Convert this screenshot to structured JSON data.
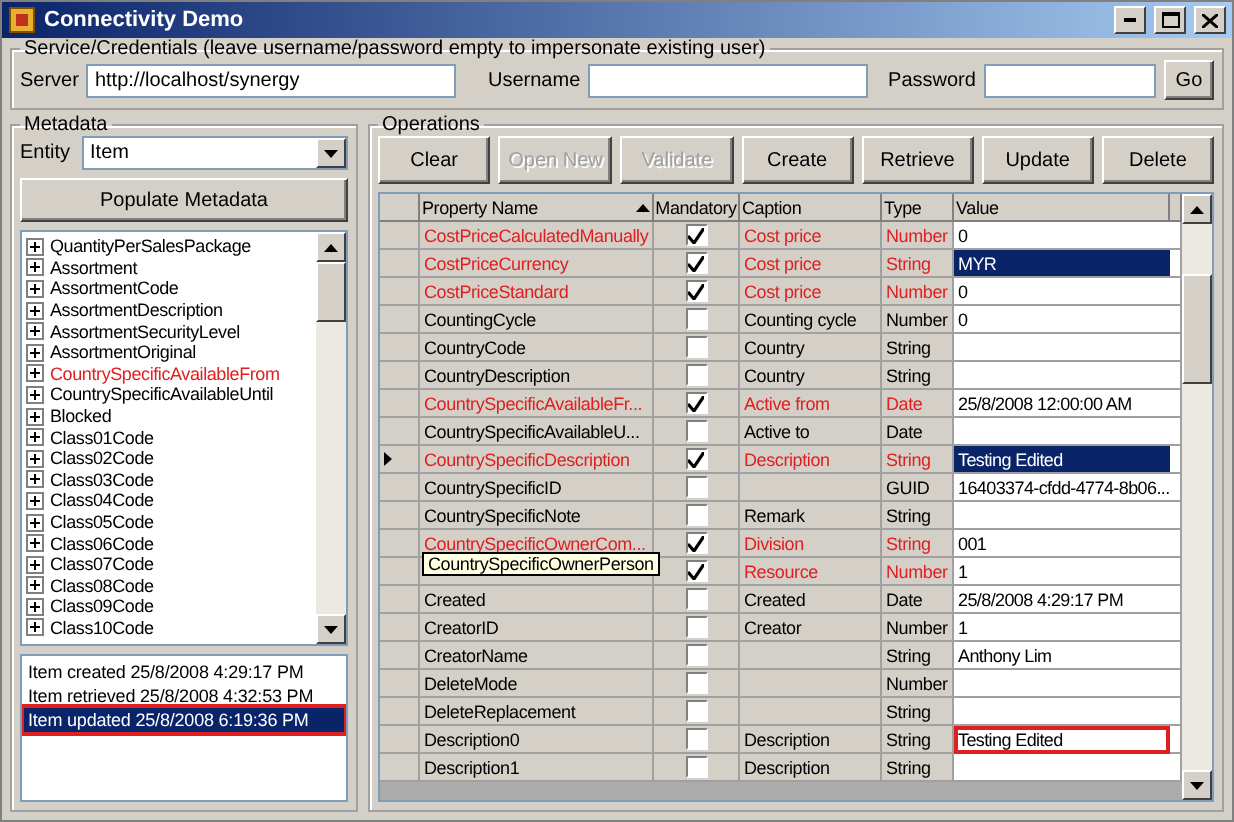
{
  "window": {
    "title": "Connectivity Demo"
  },
  "credentials": {
    "legend": "Service/Credentials (leave username/password empty to impersonate existing user)",
    "server_label": "Server",
    "server_value": "http://localhost/synergy",
    "username_label": "Username",
    "password_label": "Password",
    "go_button": "Go"
  },
  "metadata": {
    "legend": "Metadata",
    "entity_label": "Entity",
    "entity_value": "Item",
    "populate_button": "Populate Metadata",
    "tree_items": [
      {
        "label": "QuantityPerSalesPackage",
        "highlighted": false
      },
      {
        "label": "Assortment",
        "highlighted": false
      },
      {
        "label": "AssortmentCode",
        "highlighted": false
      },
      {
        "label": "AssortmentDescription",
        "highlighted": false
      },
      {
        "label": "AssortmentSecurityLevel",
        "highlighted": false
      },
      {
        "label": "AssortmentOriginal",
        "highlighted": false
      },
      {
        "label": "CountrySpecificAvailableFrom",
        "highlighted": true
      },
      {
        "label": "CountrySpecificAvailableUntil",
        "highlighted": false
      },
      {
        "label": "Blocked",
        "highlighted": false
      },
      {
        "label": "Class01Code",
        "highlighted": false
      },
      {
        "label": "Class02Code",
        "highlighted": false
      },
      {
        "label": "Class03Code",
        "highlighted": false
      },
      {
        "label": "Class04Code",
        "highlighted": false
      },
      {
        "label": "Class05Code",
        "highlighted": false
      },
      {
        "label": "Class06Code",
        "highlighted": false
      },
      {
        "label": "Class07Code",
        "highlighted": false
      },
      {
        "label": "Class08Code",
        "highlighted": false
      },
      {
        "label": "Class09Code",
        "highlighted": false
      },
      {
        "label": "Class10Code",
        "highlighted": false
      }
    ],
    "log": [
      {
        "text": "Item created 25/8/2008 4:29:17 PM",
        "selected": false,
        "outlined": false
      },
      {
        "text": "Item retrieved  25/8/2008 4:32:53 PM",
        "selected": false,
        "outlined": false
      },
      {
        "text": "Item updated 25/8/2008 6:19:36 PM",
        "selected": true,
        "outlined": true
      }
    ]
  },
  "operations": {
    "legend": "Operations",
    "buttons": [
      {
        "label": "Clear",
        "disabled": false
      },
      {
        "label": "Open New",
        "disabled": true
      },
      {
        "label": "Validate",
        "disabled": true
      },
      {
        "label": "Create",
        "disabled": false
      },
      {
        "label": "Retrieve",
        "disabled": false
      },
      {
        "label": "Update",
        "disabled": false
      },
      {
        "label": "Delete",
        "disabled": false
      }
    ],
    "table": {
      "columns": [
        "Property Name",
        "Mandatory",
        "Caption",
        "Type",
        "Value"
      ],
      "tooltip": "CountrySpecificOwnerPerson",
      "rows": [
        {
          "property": "CostPriceCalculatedManually",
          "mandatory": true,
          "caption": "Cost price",
          "type": "Number",
          "value": "0",
          "selected": false,
          "current": false,
          "outlined": false
        },
        {
          "property": "CostPriceCurrency",
          "mandatory": true,
          "caption": "Cost price",
          "type": "String",
          "value": "MYR",
          "selected": true,
          "current": false,
          "outlined": false
        },
        {
          "property": "CostPriceStandard",
          "mandatory": true,
          "caption": "Cost price",
          "type": "Number",
          "value": "0",
          "selected": false,
          "current": false,
          "outlined": false
        },
        {
          "property": "CountingCycle",
          "mandatory": false,
          "caption": "Counting cycle",
          "type": "Number",
          "value": "0",
          "selected": false,
          "current": false,
          "outlined": false
        },
        {
          "property": "CountryCode",
          "mandatory": false,
          "caption": "Country",
          "type": "String",
          "selected": false,
          "current": false,
          "outlined": false
        },
        {
          "property": "CountryDescription",
          "mandatory": false,
          "caption": "Country",
          "type": "String",
          "selected": false,
          "current": false,
          "outlined": false
        },
        {
          "property": "CountrySpecificAvailableFr...",
          "mandatory": true,
          "caption": "Active from",
          "type": "Date",
          "value": "25/8/2008 12:00:00 AM",
          "selected": false,
          "current": false,
          "outlined": false
        },
        {
          "property": "CountrySpecificAvailableU...",
          "mandatory": false,
          "caption": "Active to",
          "type": "Date",
          "selected": false,
          "current": false,
          "outlined": false
        },
        {
          "property": "CountrySpecificDescription",
          "mandatory": true,
          "caption": "Description",
          "type": "String",
          "value": "Testing Edited",
          "selected": true,
          "current": true,
          "outlined": false
        },
        {
          "property": "CountrySpecificID",
          "mandatory": false,
          "type": "GUID",
          "value": "16403374-cfdd-4774-8b06...",
          "selected": false,
          "current": false,
          "outlined": false
        },
        {
          "property": "CountrySpecificNote",
          "mandatory": false,
          "caption": "Remark",
          "type": "String",
          "selected": false,
          "current": false,
          "outlined": false
        },
        {
          "property": "CountrySpecificOwnerCom...",
          "mandatory": true,
          "caption": "Division",
          "type": "String",
          "value": "001",
          "selected": false,
          "current": false,
          "outlined": false
        },
        {
          "mandatory": true,
          "caption": "Resource",
          "type": "Number",
          "value": "1",
          "selected": false,
          "current": false,
          "outlined": false,
          "tooltip": true
        },
        {
          "property": "Created",
          "mandatory": false,
          "caption": "Created",
          "type": "Date",
          "value": "25/8/2008 4:29:17 PM",
          "selected": false,
          "current": false,
          "outlined": false
        },
        {
          "property": "CreatorID",
          "mandatory": false,
          "caption": "Creator",
          "type": "Number",
          "value": "1",
          "selected": false,
          "current": false,
          "outlined": false
        },
        {
          "property": "CreatorName",
          "mandatory": false,
          "type": "String",
          "value": "Anthony Lim",
          "selected": false,
          "current": false,
          "outlined": false
        },
        {
          "property": "DeleteMode",
          "mandatory": false,
          "type": "Number",
          "selected": false,
          "current": false,
          "outlined": false
        },
        {
          "property": "DeleteReplacement",
          "mandatory": false,
          "type": "String",
          "selected": false,
          "current": false,
          "outlined": false
        },
        {
          "property": "Description0",
          "mandatory": false,
          "caption": "Description",
          "type": "String",
          "value": "Testing Edited",
          "selected": false,
          "current": false,
          "outlined": true
        },
        {
          "property": "Description1",
          "mandatory": false,
          "caption": "Description",
          "type": "String",
          "selected": false,
          "current": false,
          "outlined": false
        }
      ]
    }
  }
}
